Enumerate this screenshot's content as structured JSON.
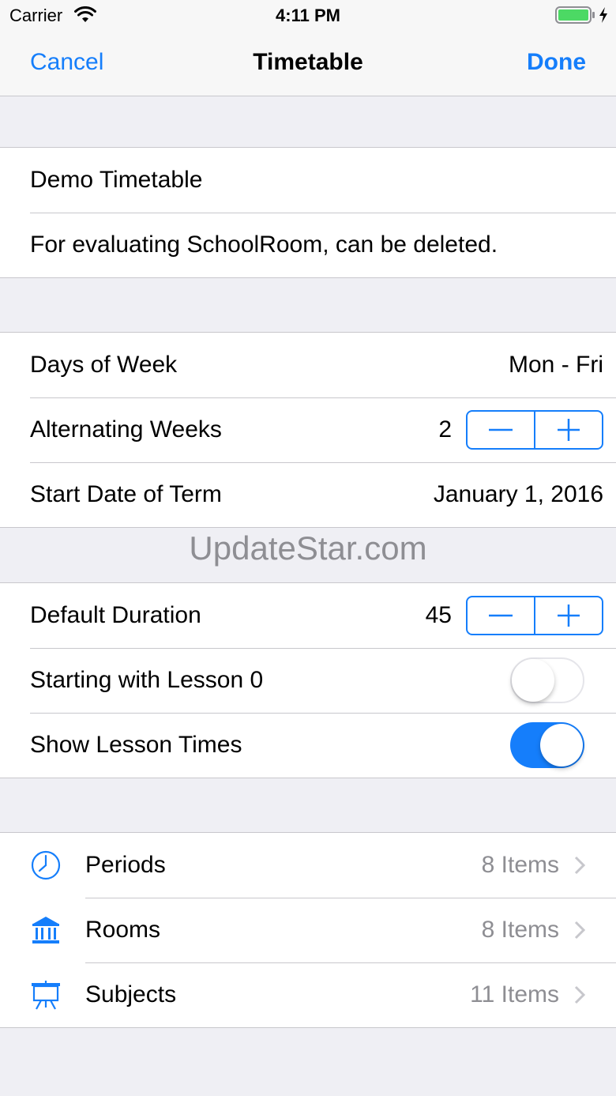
{
  "status_bar": {
    "carrier": "Carrier",
    "time": "4:11 PM",
    "wifi_icon": "wifi-icon",
    "battery_icon": "battery-icon",
    "battery_color": "#4cd964"
  },
  "nav": {
    "cancel_label": "Cancel",
    "title": "Timetable",
    "done_label": "Done"
  },
  "info": {
    "name": "Demo Timetable",
    "description": "For evaluating SchoolRoom, can be deleted."
  },
  "schedule": {
    "days_label": "Days of Week",
    "days_value": "Mon - Fri",
    "alternating_label": "Alternating Weeks",
    "alternating_value": "2",
    "start_label": "Start Date of Term",
    "start_value": "January 1, 2016"
  },
  "watermark": "UpdateStar.com",
  "lessons": {
    "duration_label": "Default Duration",
    "duration_value": "45",
    "lesson0_label": "Starting with Lesson 0",
    "lesson0_on": false,
    "times_label": "Show Lesson Times",
    "times_on": true
  },
  "lists": [
    {
      "label": "Periods",
      "detail": "8 Items",
      "icon": "clock-icon"
    },
    {
      "label": "Rooms",
      "detail": "8 Items",
      "icon": "building-icon"
    },
    {
      "label": "Subjects",
      "detail": "11 Items",
      "icon": "easel-icon"
    }
  ],
  "colors": {
    "accent": "#157efb",
    "background": "#efeff4",
    "separator": "#c8c7cc",
    "secondary_text": "#8e8e93"
  }
}
